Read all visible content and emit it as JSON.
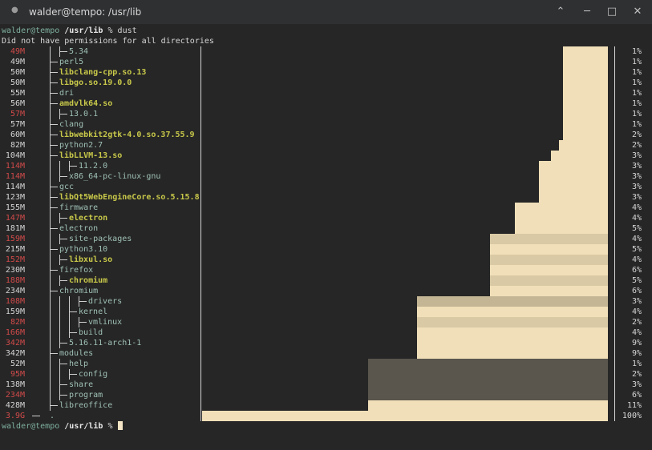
{
  "window": {
    "title": "walder@tempo: /usr/lib",
    "buttons": {
      "up": "⌃",
      "minimize": "─",
      "maximize": "□",
      "close": "✕"
    }
  },
  "prompt": {
    "user": "walder@tempo",
    "path": "/usr/lib",
    "symbol": "%",
    "command": "dust"
  },
  "warning": "Did not have permissions for all directories",
  "colors": {
    "bg": "#262626",
    "size_normal": "#d6d6d6",
    "size_red": "#d24a4a",
    "dir": "#9fc0b6",
    "file": "#c8c84a",
    "bar_empty": "#f0dfb8"
  },
  "rows": [
    {
      "size": "49M",
      "red": true,
      "depth": 2,
      "name": "5.34",
      "type": "dir",
      "pct": "1%",
      "fill": "#f0dfb8",
      "filled": 11
    },
    {
      "size": "49M",
      "red": false,
      "depth": 1,
      "name": "perl5",
      "type": "dir",
      "pct": "1%",
      "fill": "#f0dfb8",
      "filled": 11
    },
    {
      "size": "50M",
      "red": false,
      "depth": 1,
      "name": "libclang-cpp.so.13",
      "type": "file",
      "pct": "1%",
      "fill": "#f0dfb8",
      "filled": 11
    },
    {
      "size": "50M",
      "red": false,
      "depth": 1,
      "name": "libgo.so.19.0.0",
      "type": "file",
      "pct": "1%",
      "fill": "#f0dfb8",
      "filled": 11
    },
    {
      "size": "55M",
      "red": false,
      "depth": 1,
      "name": "dri",
      "type": "dir",
      "pct": "1%",
      "fill": "#f0dfb8",
      "filled": 11
    },
    {
      "size": "56M",
      "red": false,
      "depth": 1,
      "name": "amdvlk64.so",
      "type": "file",
      "pct": "1%",
      "fill": "#f0dfb8",
      "filled": 11
    },
    {
      "size": "57M",
      "red": true,
      "depth": 2,
      "name": "13.0.1",
      "type": "dir",
      "pct": "1%",
      "fill": "#f0dfb8",
      "filled": 11
    },
    {
      "size": "57M",
      "red": false,
      "depth": 1,
      "name": "clang",
      "type": "dir",
      "pct": "1%",
      "fill": "#f0dfb8",
      "filled": 11
    },
    {
      "size": "60M",
      "red": false,
      "depth": 1,
      "name": "libwebkit2gtk-4.0.so.37.55.9",
      "type": "file",
      "pct": "2%",
      "fill": "#f0dfb8",
      "filled": 11
    },
    {
      "size": "82M",
      "red": false,
      "depth": 1,
      "name": "python2.7",
      "type": "dir",
      "pct": "2%",
      "fill": "#f0dfb8",
      "filled": 12
    },
    {
      "size": "104M",
      "red": false,
      "depth": 1,
      "name": "libLLVM-13.so",
      "type": "file",
      "pct": "3%",
      "fill": "#f0dfb8",
      "filled": 14
    },
    {
      "size": "114M",
      "red": true,
      "depth": 3,
      "name": "11.2.0",
      "type": "dir",
      "pct": "3%",
      "fill": "#f0dfb8",
      "filled": 17
    },
    {
      "size": "114M",
      "red": true,
      "depth": 2,
      "name": "x86_64-pc-linux-gnu",
      "type": "dir",
      "pct": "3%",
      "fill": "#f0dfb8",
      "filled": 17
    },
    {
      "size": "114M",
      "red": false,
      "depth": 1,
      "name": "gcc",
      "type": "dir",
      "pct": "3%",
      "fill": "#f0dfb8",
      "filled": 17
    },
    {
      "size": "123M",
      "red": false,
      "depth": 1,
      "name": "libQt5WebEngineCore.so.5.15.8",
      "type": "file",
      "pct": "3%",
      "fill": "#f0dfb8",
      "filled": 17
    },
    {
      "size": "155M",
      "red": false,
      "depth": 1,
      "name": "firmware",
      "type": "dir",
      "pct": "4%",
      "fill": "#f0dfb8",
      "filled": 23
    },
    {
      "size": "147M",
      "red": true,
      "depth": 2,
      "name": "electron",
      "type": "file",
      "pct": "4%",
      "fill": "#f0dfb8",
      "filled": 23
    },
    {
      "size": "181M",
      "red": false,
      "depth": 1,
      "name": "electron",
      "type": "dir",
      "pct": "5%",
      "fill": "#f0dfb8",
      "filled": 23
    },
    {
      "size": "159M",
      "red": true,
      "depth": 2,
      "name": "site-packages",
      "type": "dir",
      "pct": "4%",
      "fill": "#d9c9a4",
      "filled": 29
    },
    {
      "size": "215M",
      "red": false,
      "depth": 1,
      "name": "python3.10",
      "type": "dir",
      "pct": "5%",
      "fill": "#f0dfb8",
      "filled": 29
    },
    {
      "size": "152M",
      "red": true,
      "depth": 2,
      "name": "libxul.so",
      "type": "file",
      "pct": "4%",
      "fill": "#d9c9a4",
      "filled": 29
    },
    {
      "size": "230M",
      "red": false,
      "depth": 1,
      "name": "firefox",
      "type": "dir",
      "pct": "6%",
      "fill": "#f0dfb8",
      "filled": 29
    },
    {
      "size": "188M",
      "red": true,
      "depth": 2,
      "name": "chromium",
      "type": "file",
      "pct": "5%",
      "fill": "#d9c9a4",
      "filled": 29
    },
    {
      "size": "234M",
      "red": false,
      "depth": 1,
      "name": "chromium",
      "type": "dir",
      "pct": "6%",
      "fill": "#f0dfb8",
      "filled": 29
    },
    {
      "size": "108M",
      "red": true,
      "depth": 4,
      "name": "drivers",
      "type": "dir",
      "pct": "3%",
      "fill": "#c4b595",
      "filled": 47
    },
    {
      "size": "159M",
      "red": false,
      "depth": 3,
      "name": "kernel",
      "type": "dir",
      "pct": "4%",
      "fill": "#f0dfb8",
      "filled": 47
    },
    {
      "size": "82M",
      "red": true,
      "depth": 4,
      "name": "vmlinux",
      "type": "dir",
      "pct": "2%",
      "fill": "#d9c9a4",
      "filled": 47
    },
    {
      "size": "166M",
      "red": true,
      "depth": 3,
      "name": "build",
      "type": "dir",
      "pct": "4%",
      "fill": "#f0dfb8",
      "filled": 47
    },
    {
      "size": "342M",
      "red": true,
      "depth": 2,
      "name": "5.16.11-arch1-1",
      "type": "dir",
      "pct": "9%",
      "fill": "#f0dfb8",
      "filled": 47
    },
    {
      "size": "342M",
      "red": false,
      "depth": 1,
      "name": "modules",
      "type": "dir",
      "pct": "9%",
      "fill": "#f0dfb8",
      "filled": 47
    },
    {
      "size": "52M",
      "red": false,
      "depth": 2,
      "name": "help",
      "type": "dir",
      "pct": "1%",
      "fill": "#5a554d",
      "filled": 59
    },
    {
      "size": "95M",
      "red": true,
      "depth": 3,
      "name": "config",
      "type": "dir",
      "pct": "2%",
      "fill": "#5a554d",
      "filled": 59
    },
    {
      "size": "138M",
      "red": false,
      "depth": 2,
      "name": "share",
      "type": "dir",
      "pct": "3%",
      "fill": "#5a554d",
      "filled": 59
    },
    {
      "size": "234M",
      "red": true,
      "depth": 2,
      "name": "program",
      "type": "dir",
      "pct": "6%",
      "fill": "#5a554d",
      "filled": 59
    },
    {
      "size": "428M",
      "red": false,
      "depth": 1,
      "name": "libreoffice",
      "type": "dir",
      "pct": "11%",
      "fill": "#f0dfb8",
      "filled": 59
    },
    {
      "size": "3.9G",
      "red": true,
      "depth": 0,
      "name": ".",
      "type": "dir",
      "pct": "100%",
      "fill": "#f0dfb8",
      "filled": 100
    }
  ]
}
